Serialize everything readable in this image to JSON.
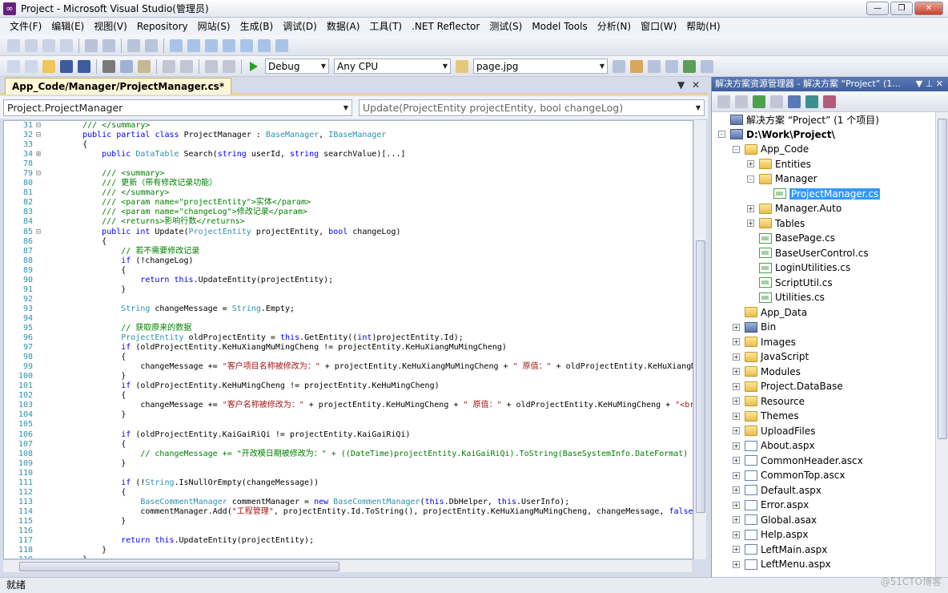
{
  "window": {
    "title": "Project - Microsoft Visual Studio(管理员)"
  },
  "menu": [
    "文件(F)",
    "编辑(E)",
    "视图(V)",
    "Repository",
    "网站(S)",
    "生成(B)",
    "调试(D)",
    "数据(A)",
    "工具(T)",
    ".NET Reflector",
    "测试(S)",
    "Model Tools",
    "分析(N)",
    "窗口(W)",
    "帮助(H)"
  ],
  "toolbar2": {
    "config": "Debug",
    "platform": "Any CPU",
    "find": "page.jpg"
  },
  "document": {
    "tab": "App_Code/Manager/ProjectManager.cs*",
    "class_combo": "Project.ProjectManager",
    "member_combo": "Update(ProjectEntity projectEntity, bool changeLog)"
  },
  "solution_explorer": {
    "title": "解决方案资源管理器 - 解决方案 “Project” (1...",
    "items": [
      {
        "label": "解决方案 “Project” (1 个项目)",
        "level": 0,
        "icon": "solution"
      },
      {
        "label": "D:\\Work\\Project\\",
        "level": 0,
        "icon": "web-project",
        "bold": true,
        "exp": "-"
      },
      {
        "label": "App_Code",
        "level": 1,
        "icon": "folder",
        "exp": "-"
      },
      {
        "label": "Entities",
        "level": 2,
        "icon": "folder",
        "exp": "+"
      },
      {
        "label": "Manager",
        "level": 2,
        "icon": "folder",
        "exp": "-"
      },
      {
        "label": "ProjectManager.cs",
        "level": 3,
        "icon": "cs",
        "selected": true
      },
      {
        "label": "Manager.Auto",
        "level": 2,
        "icon": "folder",
        "exp": "+"
      },
      {
        "label": "Tables",
        "level": 2,
        "icon": "folder",
        "exp": "+"
      },
      {
        "label": "BasePage.cs",
        "level": 2,
        "icon": "cs"
      },
      {
        "label": "BaseUserControl.cs",
        "level": 2,
        "icon": "cs"
      },
      {
        "label": "LoginUtilities.cs",
        "level": 2,
        "icon": "cs"
      },
      {
        "label": "ScriptUtil.cs",
        "level": 2,
        "icon": "cs"
      },
      {
        "label": "Utilities.cs",
        "level": 2,
        "icon": "cs"
      },
      {
        "label": "App_Data",
        "level": 1,
        "icon": "folder"
      },
      {
        "label": "Bin",
        "level": 1,
        "icon": "bin",
        "exp": "+"
      },
      {
        "label": "Images",
        "level": 1,
        "icon": "folder",
        "exp": "+"
      },
      {
        "label": "JavaScript",
        "level": 1,
        "icon": "folder",
        "exp": "+"
      },
      {
        "label": "Modules",
        "level": 1,
        "icon": "folder",
        "exp": "+"
      },
      {
        "label": "Project.DataBase",
        "level": 1,
        "icon": "folder",
        "exp": "+"
      },
      {
        "label": "Resource",
        "level": 1,
        "icon": "folder",
        "exp": "+"
      },
      {
        "label": "Themes",
        "level": 1,
        "icon": "folder",
        "exp": "+"
      },
      {
        "label": "UploadFiles",
        "level": 1,
        "icon": "folder",
        "exp": "+"
      },
      {
        "label": "About.aspx",
        "level": 1,
        "icon": "aspx",
        "exp": "+"
      },
      {
        "label": "CommonHeader.ascx",
        "level": 1,
        "icon": "aspx",
        "exp": "+"
      },
      {
        "label": "CommonTop.ascx",
        "level": 1,
        "icon": "aspx",
        "exp": "+"
      },
      {
        "label": "Default.aspx",
        "level": 1,
        "icon": "aspx",
        "exp": "+"
      },
      {
        "label": "Error.aspx",
        "level": 1,
        "icon": "aspx",
        "exp": "+"
      },
      {
        "label": "Global.asax",
        "level": 1,
        "icon": "aspx",
        "exp": "+"
      },
      {
        "label": "Help.aspx",
        "level": 1,
        "icon": "aspx",
        "exp": "+"
      },
      {
        "label": "LeftMain.aspx",
        "level": 1,
        "icon": "aspx",
        "exp": "+"
      },
      {
        "label": "LeftMenu.aspx",
        "level": 1,
        "icon": "aspx",
        "exp": "+"
      }
    ]
  },
  "status": "就绪",
  "watermark": "@51CTO博客",
  "code": [
    {
      "n": "31",
      "g": "-",
      "t": "    /// </summary>",
      "c": "xd"
    },
    {
      "n": "32",
      "g": "-",
      "t": "    public partial class ProjectManager : BaseManager, IBaseManager",
      "c": "kw"
    },
    {
      "n": "33",
      "g": "",
      "t": "    {",
      "c": ""
    },
    {
      "n": "34",
      "g": "+",
      "t": "        public DataTable Search(string userId, string searchValue)[...]",
      "c": ""
    },
    {
      "n": "78",
      "g": "",
      "t": "",
      "c": ""
    },
    {
      "n": "79",
      "g": "-",
      "t": "        /// <summary>",
      "c": "xd"
    },
    {
      "n": "80",
      "g": "",
      "t": "        /// 更新（带有修改记录功能）",
      "c": "cm"
    },
    {
      "n": "81",
      "g": "",
      "t": "        /// </summary>",
      "c": "xd"
    },
    {
      "n": "82",
      "g": "",
      "t": "        /// <param name=\"projectEntity\">实体</param>",
      "c": "xd"
    },
    {
      "n": "83",
      "g": "",
      "t": "        /// <param name=\"changeLog\">修改记录</param>",
      "c": "xd"
    },
    {
      "n": "84",
      "g": "",
      "t": "        /// <returns>影响行数</returns>",
      "c": "xd"
    },
    {
      "n": "85",
      "g": "-",
      "t": "        public int Update(ProjectEntity projectEntity, bool changeLog)",
      "c": ""
    },
    {
      "n": "86",
      "g": "",
      "t": "        {",
      "c": ""
    },
    {
      "n": "87",
      "g": "",
      "t": "            // 若不需要修改记录",
      "c": "cm"
    },
    {
      "n": "88",
      "g": "",
      "t": "            if (!changeLog)",
      "c": ""
    },
    {
      "n": "89",
      "g": "",
      "t": "            {",
      "c": ""
    },
    {
      "n": "90",
      "g": "",
      "t": "                return this.UpdateEntity(projectEntity);",
      "c": ""
    },
    {
      "n": "91",
      "g": "",
      "t": "            }",
      "c": ""
    },
    {
      "n": "92",
      "g": "",
      "t": "",
      "c": ""
    },
    {
      "n": "93",
      "g": "",
      "t": "            String changeMessage = String.Empty;",
      "c": ""
    },
    {
      "n": "94",
      "g": "",
      "t": "",
      "c": ""
    },
    {
      "n": "95",
      "g": "",
      "t": "            // 获取原来的数据",
      "c": "cm"
    },
    {
      "n": "96",
      "g": "",
      "t": "            ProjectEntity oldProjectEntity = this.GetEntity((int)projectEntity.Id);",
      "c": ""
    },
    {
      "n": "97",
      "g": "",
      "t": "            if (oldProjectEntity.KeHuXiangMuMingCheng != projectEntity.KeHuXiangMuMingCheng)",
      "c": ""
    },
    {
      "n": "98",
      "g": "",
      "t": "            {",
      "c": ""
    },
    {
      "n": "99",
      "g": "",
      "t": "                changeMessage += \"客户项目名称被修改为：\" + projectEntity.KeHuXiangMuMingCheng + \" 原值：\" + oldProjectEntity.KeHuXiangMuMingCheng",
      "c": ""
    },
    {
      "n": "100",
      "g": "",
      "t": "            }",
      "c": ""
    },
    {
      "n": "101",
      "g": "",
      "t": "            if (oldProjectEntity.KeHuMingCheng != projectEntity.KeHuMingCheng)",
      "c": ""
    },
    {
      "n": "102",
      "g": "",
      "t": "            {",
      "c": ""
    },
    {
      "n": "103",
      "g": "",
      "t": "                changeMessage += \"客户名称被修改为：\" + projectEntity.KeHuMingCheng + \" 原值：\" + oldProjectEntity.KeHuMingCheng + \"<br>\";",
      "c": ""
    },
    {
      "n": "104",
      "g": "",
      "t": "            }",
      "c": ""
    },
    {
      "n": "105",
      "g": "",
      "t": "",
      "c": ""
    },
    {
      "n": "106",
      "g": "",
      "t": "            if (oldProjectEntity.KaiGaiRiQi != projectEntity.KaiGaiRiQi)",
      "c": ""
    },
    {
      "n": "107",
      "g": "",
      "t": "            {",
      "c": ""
    },
    {
      "n": "108",
      "g": "",
      "t": "                // changeMessage += \"开改模日期被修改为：\" + ((DateTime)projectEntity.KaiGaiRiQi).ToString(BaseSystemInfo.DateFormat) + \" 原值：\"",
      "c": "cm"
    },
    {
      "n": "109",
      "g": "",
      "t": "            }",
      "c": ""
    },
    {
      "n": "110",
      "g": "",
      "t": "",
      "c": ""
    },
    {
      "n": "111",
      "g": "",
      "t": "            if (!String.IsNullOrEmpty(changeMessage))",
      "c": ""
    },
    {
      "n": "112",
      "g": "",
      "t": "            {",
      "c": ""
    },
    {
      "n": "113",
      "g": "",
      "t": "                BaseCommentManager commentManager = new BaseCommentManager(this.DbHelper, this.UserInfo);",
      "c": ""
    },
    {
      "n": "114",
      "g": "",
      "t": "                commentManager.Add(\"工程管理\", projectEntity.Id.ToString(), projectEntity.KeHuXiangMuMingCheng, changeMessage, false, String.Empty",
      "c": ""
    },
    {
      "n": "115",
      "g": "",
      "t": "            }",
      "c": ""
    },
    {
      "n": "116",
      "g": "",
      "t": "",
      "c": ""
    },
    {
      "n": "117",
      "g": "",
      "t": "            return this.UpdateEntity(projectEntity);",
      "c": ""
    },
    {
      "n": "118",
      "g": "",
      "t": "        }",
      "c": ""
    },
    {
      "n": "119",
      "g": "",
      "t": "    }",
      "c": ""
    }
  ]
}
